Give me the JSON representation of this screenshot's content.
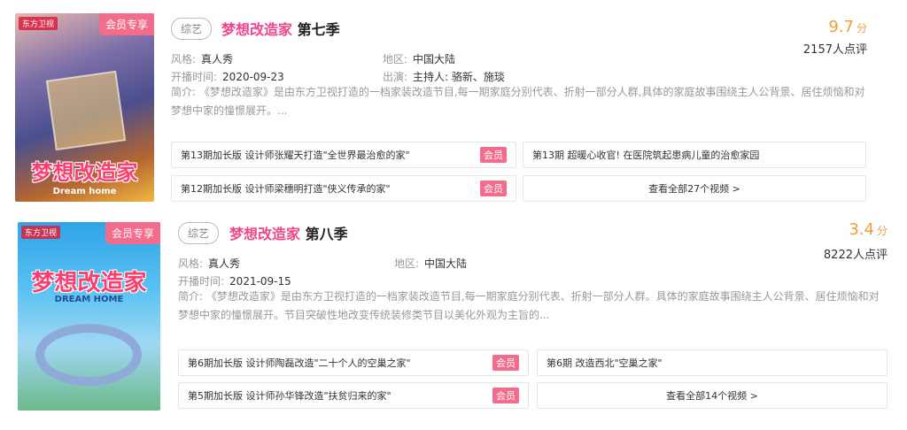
{
  "shows": [
    {
      "vip_tag": "会员专享",
      "poster_brand": "东方卫视",
      "poster_title": "梦想改造家",
      "poster_sub": "Dream home",
      "genre": "综艺",
      "title_highlight": "梦想改造家",
      "title_rest": "第七季",
      "score": "9.7",
      "score_unit": "分",
      "rating_count": "2157人点评",
      "style_label": "风格:",
      "style_value": "真人秀",
      "region_label": "地区:",
      "region_value": "中国大陆",
      "date_label": "开播时间:",
      "date_value": "2020-09-23",
      "cast_label": "出演:",
      "cast_value": "主持人: 骆新、施琰",
      "desc": "简介: 《梦想改造家》是由东方卫视打造的一档家装改造节目,每一期家庭分别代表、折射一部分人群,具体的家庭故事围绕主人公背景、居住烦恼和对梦想中家的憧憬展开。...",
      "episodes": [
        {
          "text": "第13期加长版 设计师张耀天打造\"全世界最治愈的家\"",
          "badge": "会员"
        },
        {
          "text": "第13期 超暖心收官! 在医院筑起患病儿童的治愈家园",
          "badge": ""
        },
        {
          "text": "第12期加长版 设计师梁穗明打造\"侠义传承的家\"",
          "badge": "会员"
        }
      ],
      "view_all": "查看全部27个视频 >"
    },
    {
      "vip_tag": "会员专享",
      "poster_brand": "东方卫视",
      "poster_title": "梦想改造家",
      "poster_sub": "DREAM HOME",
      "genre": "综艺",
      "title_highlight": "梦想改造家",
      "title_rest": "第八季",
      "score": "3.4",
      "score_unit": "分",
      "rating_count": "8222人点评",
      "style_label": "风格:",
      "style_value": "真人秀",
      "region_label": "地区:",
      "region_value": "中国大陆",
      "date_label": "开播时间:",
      "date_value": "2021-09-15",
      "desc": "简介: 《梦想改造家》是由东方卫视打造的一档家装改造节目,每一期家庭分别代表、折射一部分人群。具体的家庭故事围绕主人公背景、居住烦恼和对梦想中家的憧憬展开。节目突破性地改变传统装修类节目以美化外观为主旨的...",
      "episodes": [
        {
          "text": "第6期加长版 设计师陶磊改造\"二十个人的空巢之家\"",
          "badge": "会员"
        },
        {
          "text": "第6期 改造西北\"空巢之家\"",
          "badge": ""
        },
        {
          "text": "第5期加长版 设计师孙华锋改造\"扶贫归来的家\"",
          "badge": "会员"
        }
      ],
      "view_all": "查看全部14个视频 >"
    }
  ]
}
